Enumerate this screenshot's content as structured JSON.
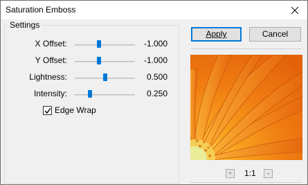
{
  "window": {
    "title": "Saturation Emboss"
  },
  "settings": {
    "legend": "Settings",
    "params": [
      {
        "label": "X Offset:",
        "value": "-1.000",
        "level": 0.4
      },
      {
        "label": "Y Offset:",
        "value": "-1.000",
        "level": 0.4
      },
      {
        "label": "Lightness:",
        "value": "0.500",
        "level": 0.5
      },
      {
        "label": "Intensity:",
        "value": "0.250",
        "level": 0.25
      }
    ],
    "edge_wrap": {
      "label": "Edge Wrap",
      "checked": true
    }
  },
  "buttons": {
    "apply": "Apply",
    "cancel": "Cancel"
  },
  "preview": {
    "zoom_in": "+",
    "zoom_level": "1:1",
    "zoom_out": "-"
  },
  "colors": {
    "accent": "#0078d7",
    "window_bg": "#f0f0f0",
    "preview_orange": "#f28a1a"
  }
}
